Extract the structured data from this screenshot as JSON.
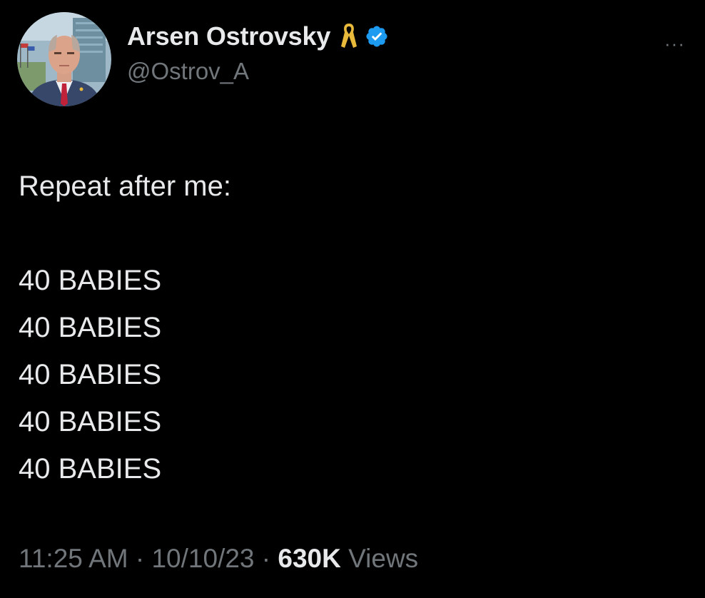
{
  "tweet": {
    "author": {
      "display_name": "Arsen Ostrovsky",
      "handle": "@Ostrov_A",
      "ribbon_icon": "yellow-ribbon-icon",
      "verified_icon": "verified-badge-icon",
      "verified_color": "#1d9bf0",
      "ribbon_color": "#e8b93a"
    },
    "more_label": "···",
    "text": {
      "lead": "Repeat after me:",
      "lines": [
        "40 BABIES",
        "40 BABIES",
        "40 BABIES",
        "40 BABIES",
        "40 BABIES"
      ]
    },
    "meta": {
      "time": "11:25 AM",
      "sep1": " · ",
      "date": "10/10/23",
      "sep2": " · ",
      "views_count": "630K",
      "views_label": " Views"
    }
  },
  "colors": {
    "background": "#000000",
    "primary_text": "#e7e9ea",
    "secondary_text": "#71767b"
  }
}
